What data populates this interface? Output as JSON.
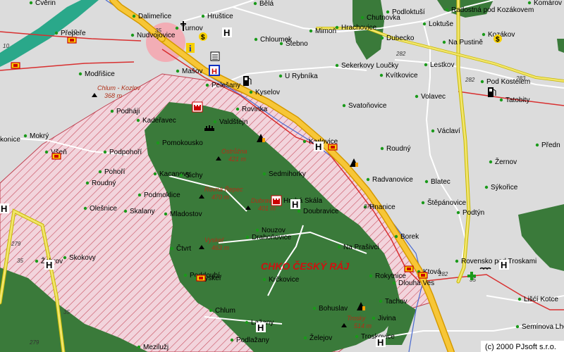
{
  "map": {
    "region_label": "CHKO ČESKÝ RÁJ",
    "copyright": "(c) 2000 PJsoft s.r.o.",
    "towns": [
      {
        "id": "cverin",
        "name": "Cvěrin"
      },
      {
        "id": "bela",
        "name": "Bělá"
      },
      {
        "id": "komarov",
        "name": "Komárov"
      },
      {
        "id": "podloktusi",
        "name": "Podloktuší"
      },
      {
        "id": "radostna",
        "name": "Radostná pod Kozákovem"
      },
      {
        "id": "dalimerice",
        "name": "Dalimeřice"
      },
      {
        "id": "hrustice",
        "name": "Hruštice"
      },
      {
        "id": "chutnovka",
        "name": "Chutnovka"
      },
      {
        "id": "hrachovice",
        "name": "Hrachovice"
      },
      {
        "id": "loktuse",
        "name": "Loktuše"
      },
      {
        "id": "turnov",
        "name": "Turnov"
      },
      {
        "id": "prepere",
        "name": "Přepeře"
      },
      {
        "id": "nudvojovice",
        "name": "Nudvojovice"
      },
      {
        "id": "mimon",
        "name": "Mimoň"
      },
      {
        "id": "dubecko",
        "name": "Dubecko"
      },
      {
        "id": "kozakov",
        "name": "Kozákov"
      },
      {
        "id": "chlumek",
        "name": "Chloumek"
      },
      {
        "id": "stebno",
        "name": "Štebno"
      },
      {
        "id": "napustine",
        "name": "Na Pustině"
      },
      {
        "id": "masov",
        "name": "Mašov"
      },
      {
        "id": "modrisice",
        "name": "Modřišice"
      },
      {
        "id": "lestkov",
        "name": "Lestkov"
      },
      {
        "id": "sekerkovy",
        "name": "Sekerkovy Loučky"
      },
      {
        "id": "kvitkovice",
        "name": "Kvítkovice"
      },
      {
        "id": "urybnika",
        "name": "U Rybníka"
      },
      {
        "id": "pelesany",
        "name": "Pelešany"
      },
      {
        "id": "podkostelem",
        "name": "Pod Kostelem"
      },
      {
        "id": "kyselov",
        "name": "Kyselov"
      },
      {
        "id": "volavec",
        "name": "Volavec"
      },
      {
        "id": "tatobity",
        "name": "Tatobity"
      },
      {
        "id": "rovinka",
        "name": "Rovinka"
      },
      {
        "id": "podhaji",
        "name": "Podháji"
      },
      {
        "id": "svatonovice",
        "name": "Svatoňovice"
      },
      {
        "id": "kaderavec",
        "name": "Kadeřavec"
      },
      {
        "id": "valdstejn",
        "name": "Valdštejn"
      },
      {
        "id": "vaclavi",
        "name": "Václaví"
      },
      {
        "id": "mokry",
        "name": "Mokrý"
      },
      {
        "id": "pomokousko",
        "name": "Pomokousko"
      },
      {
        "id": "karlovice",
        "name": "Karlovice"
      },
      {
        "id": "konice",
        "name": "konice"
      },
      {
        "id": "vsen",
        "name": "Všeň"
      },
      {
        "id": "predni",
        "name": "Předn"
      },
      {
        "id": "podpohori",
        "name": "Podpohoří"
      },
      {
        "id": "roudny1",
        "name": "Roudný"
      },
      {
        "id": "zernov",
        "name": "Žernov"
      },
      {
        "id": "pohori",
        "name": "Pohoří"
      },
      {
        "id": "kacanovy",
        "name": "Kacanovy"
      },
      {
        "id": "sichy",
        "name": "Sichy"
      },
      {
        "id": "sedmihorky",
        "name": "Sedmihorky"
      },
      {
        "id": "radvanovice",
        "name": "Radvanovice"
      },
      {
        "id": "blatec",
        "name": "Blatec"
      },
      {
        "id": "roudny2",
        "name": "Roudný"
      },
      {
        "id": "sykorice",
        "name": "Sýkořice"
      },
      {
        "id": "podmoklice",
        "name": "Podmoklice"
      },
      {
        "id": "hrubaskala",
        "name": "Hrubá Skála"
      },
      {
        "id": "hnanice",
        "name": "Hnanice"
      },
      {
        "id": "stepanovice",
        "name": "Štěpánovice"
      },
      {
        "id": "olesnice",
        "name": "Olešnice"
      },
      {
        "id": "skalany",
        "name": "Skalany"
      },
      {
        "id": "doubravice",
        "name": "Doubravice"
      },
      {
        "id": "podtyn",
        "name": "Podtýn"
      },
      {
        "id": "mladostov",
        "name": "Mladostov"
      },
      {
        "id": "nouzov",
        "name": "Nouzov"
      },
      {
        "id": "drahonovice",
        "name": "Drahoňovice"
      },
      {
        "id": "borek",
        "name": "Borek"
      },
      {
        "id": "ctvrt",
        "name": "Čtvrt"
      },
      {
        "id": "naprasivci",
        "name": "Na Prašivci"
      },
      {
        "id": "zehrov",
        "name": "Žehrov"
      },
      {
        "id": "skokovy",
        "name": "Skokovy"
      },
      {
        "id": "rovensko",
        "name": "Rovensko pod Troskami"
      },
      {
        "id": "rokytnice",
        "name": "Rokytnice"
      },
      {
        "id": "ktova",
        "name": "Ktová"
      },
      {
        "id": "poddoubi",
        "name": "Poddoubí"
      },
      {
        "id": "vysker",
        "name": "Vyskeř"
      },
      {
        "id": "krckovice",
        "name": "Krčkovice"
      },
      {
        "id": "dlouhaves",
        "name": "Dlouhá Ves"
      },
      {
        "id": "liscikot",
        "name": "Lišćí Kotce"
      },
      {
        "id": "tachov",
        "name": "Tachov"
      },
      {
        "id": "chlum",
        "name": "Chlum"
      },
      {
        "id": "bohuslav",
        "name": "Bohuslav"
      },
      {
        "id": "lazany",
        "name": "Lažany"
      },
      {
        "id": "jivina",
        "name": "Jivina"
      },
      {
        "id": "seminova",
        "name": "Semínova Lhota"
      },
      {
        "id": "podlazany",
        "name": "Podlažany"
      },
      {
        "id": "zelejov",
        "name": "Želejov"
      },
      {
        "id": "troskovice",
        "name": "Troskovice"
      },
      {
        "id": "meziluzi",
        "name": "Mezilužj"
      }
    ],
    "peaks": [
      {
        "id": "chlum_kozlov",
        "name": "Chlum - Kozlov",
        "elev": "368 m"
      },
      {
        "id": "ostruzna",
        "name": "Ostrůžna",
        "elev": "421 m"
      },
      {
        "id": "rovna_repec",
        "name": "Rovná Řepec",
        "elev": "470 m"
      },
      {
        "id": "dubrava",
        "name": "Dubrava",
        "elev": "401 m"
      },
      {
        "id": "vysker_peak",
        "name": "Vyskeř",
        "elev": "463 m"
      },
      {
        "id": "trosky",
        "name": "Trosky",
        "elev": "514 m"
      }
    ],
    "road_numbers": [
      "10",
      "35",
      "10",
      "282",
      "282",
      "283",
      "35",
      "35",
      "279",
      "279",
      "283",
      "279",
      "282",
      "35"
    ],
    "icons": [
      "hotel-icon",
      "restaurant-icon",
      "info-icon",
      "fuel-icon",
      "castle-icon",
      "hospital-icon",
      "ruin-icon",
      "campsite-icon",
      "cinema-icon",
      "bank-icon",
      "church-icon",
      "shop-icon",
      "medical-cross-icon"
    ]
  }
}
